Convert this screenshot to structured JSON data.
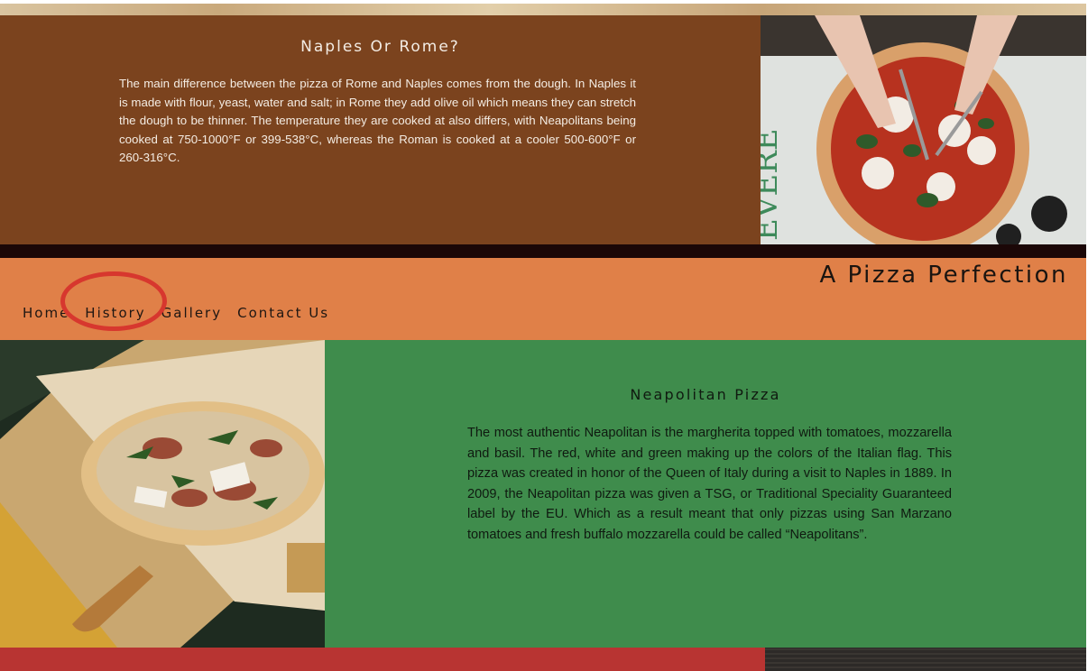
{
  "rome_section": {
    "heading": "Naples Or Rome?",
    "body": "The main difference between the pizza of Rome and Naples comes from the dough. In Naples it is made with flour, yeast, water and salt; in Rome they add olive oil which means they can stretch the dough to be thinner. The temperature they are cooked at also differs, with Neapolitans being cooked at 750-1000°F or 399-538°C, whereas the Roman is cooked at a cooler 500-600°F or 260-316°C."
  },
  "header": {
    "site_title": "A Pizza Perfection",
    "nav": [
      {
        "label": "Home"
      },
      {
        "label": "History"
      },
      {
        "label": "Gallery"
      },
      {
        "label": "Contact Us"
      }
    ]
  },
  "neapolitan_section": {
    "heading": "Neapolitan Pizza",
    "body": "The most authentic Neapolitan is the margherita topped with tomatoes, mozzarella and basil. The red, white and green making up the colors of the Italian flag. This pizza was created in honor of the Queen of Italy during a visit to Naples in 1889. In 2009, the Neapolitan pizza was given a TSG, or Traditional Speciality Guaranteed label by the EU. Which as a result meant that only pizzas using San Marzano tomatoes and fresh buffalo mozzarella could be called “Neapolitans”."
  },
  "colors": {
    "rome_bg": "#7b431e",
    "nav_bg": "#e08048",
    "neapolitan_bg": "#3f8c4c",
    "bottom_bg": "#b83432",
    "annotation": "#d7372e"
  }
}
